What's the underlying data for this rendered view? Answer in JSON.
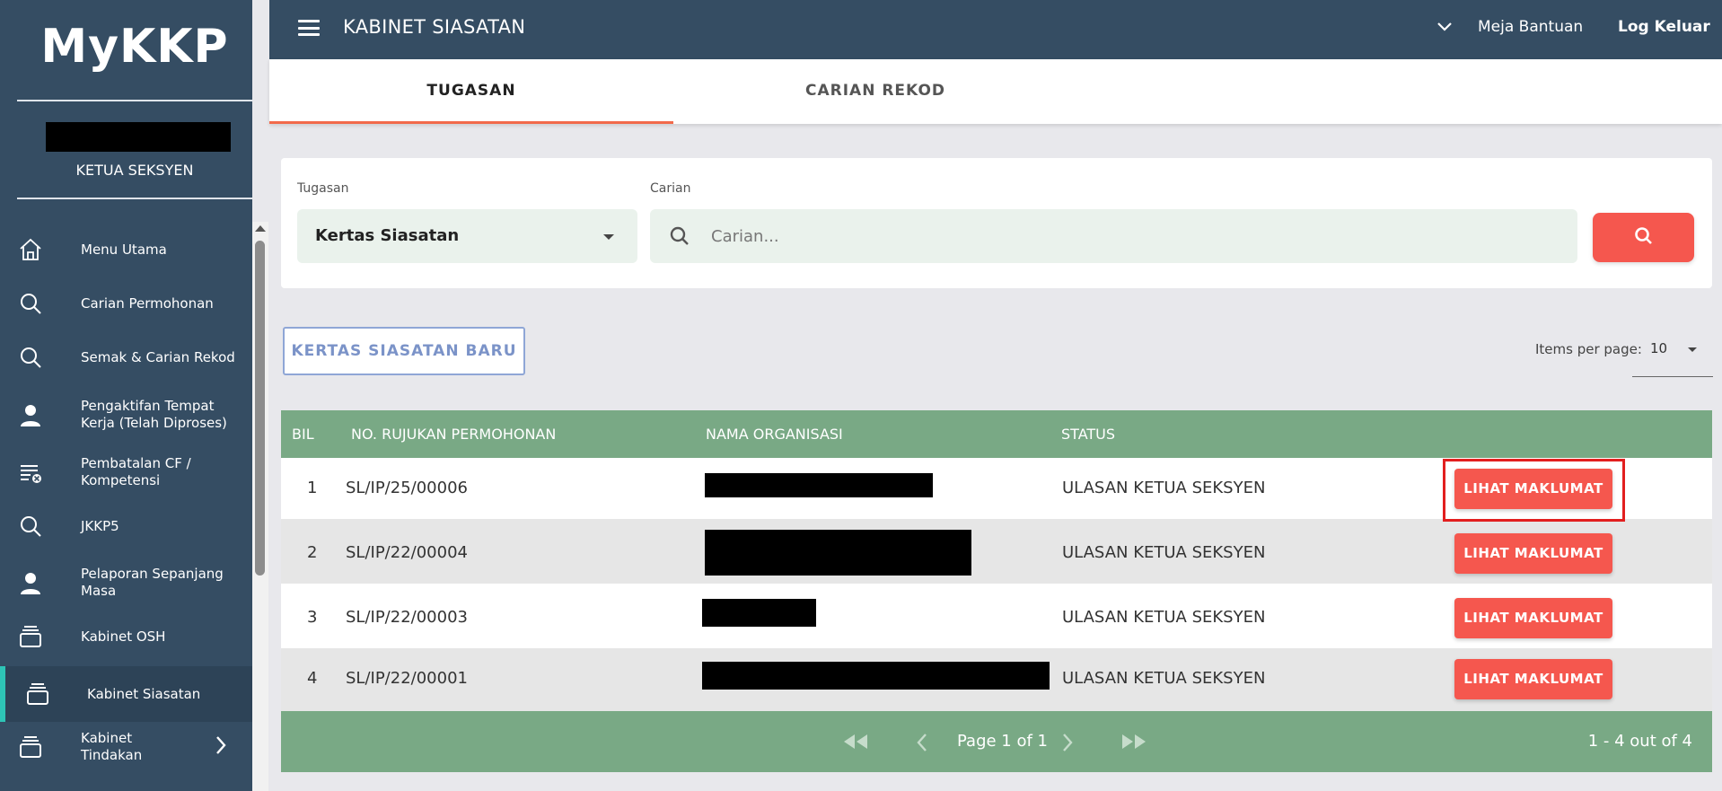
{
  "sidebar": {
    "logo": "MyKKP",
    "role": "KETUA SEKSYEN",
    "items": [
      {
        "label": "Menu Utama",
        "icon": "home-icon"
      },
      {
        "label": "Carian Permohonan",
        "icon": "search-icon"
      },
      {
        "label": "Semak & Carian Rekod",
        "icon": "search-icon"
      },
      {
        "label": "Pengaktifan Tempat Kerja (Telah Diproses)",
        "icon": "person-icon"
      },
      {
        "label": "Pembatalan CF / Kompetensi",
        "icon": "list-cancel-icon"
      },
      {
        "label": "JKKP5",
        "icon": "search-icon"
      },
      {
        "label": "Pelaporan Sepanjang Masa",
        "icon": "person-icon"
      },
      {
        "label": "Kabinet OSH",
        "icon": "cabinet-icon"
      },
      {
        "label": "Kabinet Siasatan",
        "icon": "cabinet-icon"
      },
      {
        "label": "Kabinet Tindakan",
        "icon": "cabinet-icon"
      }
    ],
    "active_index": 8
  },
  "header": {
    "title": "KABINET SIASATAN",
    "help": "Meja Bantuan",
    "logout": "Log Keluar"
  },
  "tabs": [
    {
      "label": "TUGASAN",
      "active": true
    },
    {
      "label": "CARIAN REKOD",
      "active": false
    }
  ],
  "filter": {
    "task_label": "Tugasan",
    "task_value": "Kertas Siasatan",
    "search_label": "Carian",
    "search_placeholder": "Carian..."
  },
  "new_button": "KERTAS SIASATAN BARU",
  "pagination_top": {
    "label": "Items per page:",
    "value": "10"
  },
  "table": {
    "columns": [
      "BIL",
      "NO. RUJUKAN PERMOHONAN",
      "NAMA ORGANISASI",
      "STATUS"
    ],
    "rows": [
      {
        "bil": "1",
        "ref": "SL/IP/25/00006",
        "status": "ULASAN KETUA SEKSYEN",
        "action": "LIHAT MAKLUMAT"
      },
      {
        "bil": "2",
        "ref": "SL/IP/22/00004",
        "status": "ULASAN KETUA SEKSYEN",
        "action": "LIHAT MAKLUMAT"
      },
      {
        "bil": "3",
        "ref": "SL/IP/22/00003",
        "status": "ULASAN KETUA SEKSYEN",
        "action": "LIHAT MAKLUMAT"
      },
      {
        "bil": "4",
        "ref": "SL/IP/22/00001",
        "status": "ULASAN KETUA SEKSYEN",
        "action": "LIHAT MAKLUMAT"
      }
    ]
  },
  "pager": {
    "page_text": "Page 1 of 1",
    "range_text": "1 - 4 out of 4"
  },
  "colors": {
    "sidebar_bg": "#354d63",
    "accent": "#f5574e",
    "table_header": "#79a985",
    "tab_underline": "#f26a4b",
    "active_bar": "#2ec4b6"
  }
}
